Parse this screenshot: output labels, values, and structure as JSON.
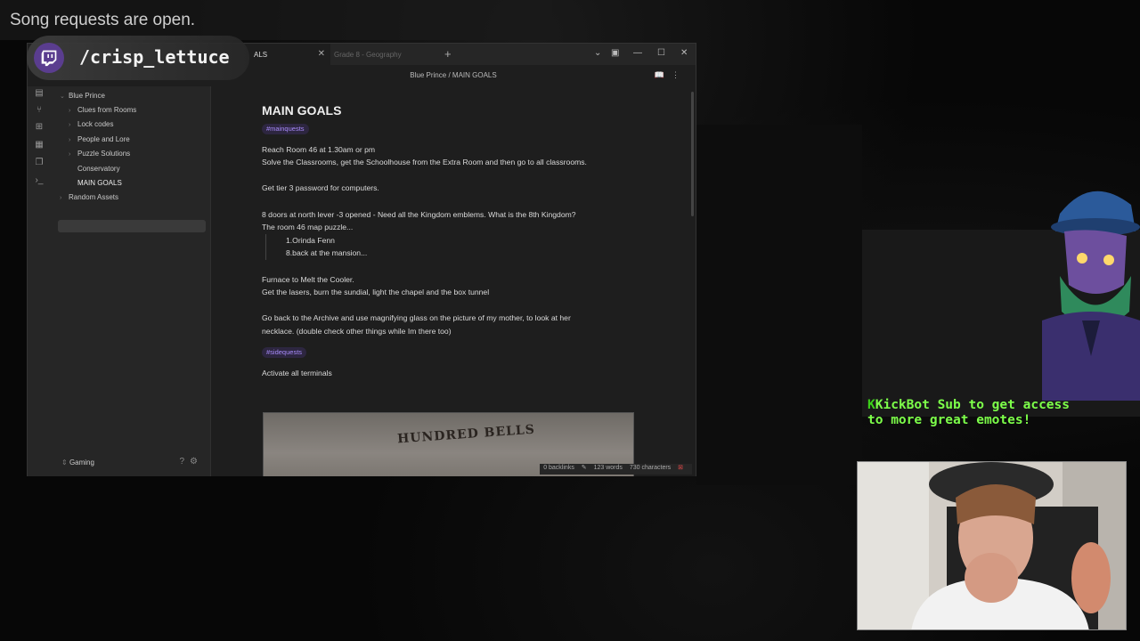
{
  "overlay": {
    "song_requests": "Song requests are open.",
    "twitch_handle": "/crisp_lettuce",
    "kickbot_name": "KickBot",
    "kickbot_message": "Sub to get access to more great emotes!",
    "kick_color": "#7dff4a"
  },
  "window": {
    "tabs": [
      {
        "label": "ALS",
        "active": true
      },
      {
        "label": "Grade 8 - Geography",
        "active": false
      }
    ],
    "breadcrumb": {
      "parent": "Blue Prince",
      "sep": "/",
      "current": "MAIN GOALS"
    }
  },
  "sidebar": {
    "root": "Blue Prince",
    "items": [
      {
        "label": "Clues from Rooms",
        "has_children": true
      },
      {
        "label": "Lock codes",
        "has_children": true
      },
      {
        "label": "People and Lore",
        "has_children": true
      },
      {
        "label": "Puzzle Solutions",
        "has_children": true
      },
      {
        "label": "Conservatory",
        "has_children": false
      },
      {
        "label": "MAIN GOALS",
        "has_children": false,
        "selected": true
      }
    ],
    "other_root": "Random Assets",
    "vault_name": "Gaming"
  },
  "note": {
    "title": "MAIN GOALS",
    "tag1": "#mainquests",
    "lines": [
      "Reach Room 46 at 1.30am or pm",
      "Solve the Classrooms, get the Schoolhouse from the Extra Room and then go to all classrooms.",
      "Get tier 3 password for computers.",
      "8 doors at north lever -3 opened - Need all the Kingdom emblems. What is the 8th Kingdom?",
      "The room 46 map puzzle...",
      "1.Orinda Fenn",
      "8.back at the mansion...",
      "Furnace to Melt the Cooler.",
      "Get the lasers, burn the sundial, light the chapel and the box tunnel",
      "Go back to the Archive and use magnifying glass on the picture of my mother, to look at her",
      "necklace. (double check other things while Im there too)"
    ],
    "tag2": "#sidequests",
    "after_tag2": "Activate all terminals",
    "image_text": "HUNDRED BELLS"
  },
  "status": {
    "backlinks": "0 backlinks",
    "words": "123 words",
    "characters": "730 characters"
  }
}
